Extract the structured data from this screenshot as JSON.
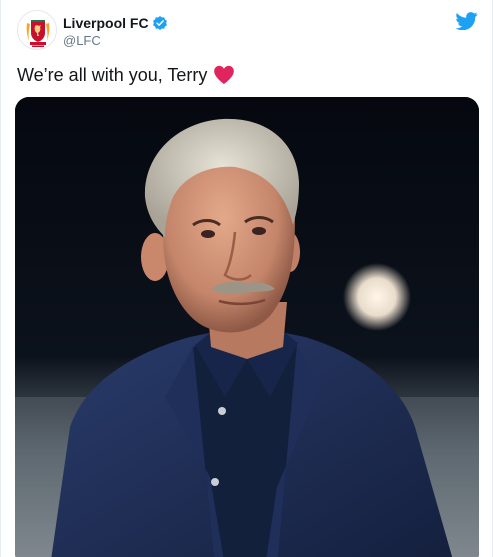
{
  "tweet": {
    "author": {
      "display_name": "Liverpool FC",
      "handle": "@LFC",
      "verified": true,
      "avatar_icon": "liverpool-crest-icon"
    },
    "platform_icon": "twitter-bird-icon",
    "text": "We’re all with you, Terry",
    "emoji": "red-heart-icon",
    "media": {
      "kind": "photo"
    }
  },
  "colors": {
    "accent": "#1da1f2",
    "heart": "#e0245e",
    "crest_red": "#c8102e",
    "jacket_navy": "#1c2c54"
  }
}
